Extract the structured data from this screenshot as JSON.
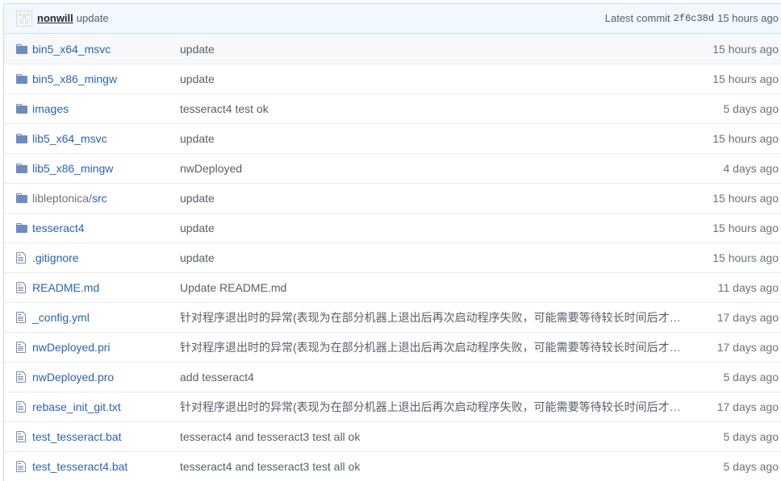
{
  "header": {
    "author": "nonwill",
    "commit_message": "update",
    "latest_commit_label": "Latest commit",
    "commit_sha": "2f6c38d",
    "commit_age": "15 hours ago"
  },
  "files": [
    {
      "icon": "folder-icon",
      "name": "bin5_x64_msvc",
      "message": "update",
      "age": "15 hours ago"
    },
    {
      "icon": "folder-icon",
      "name": "bin5_x86_mingw",
      "message": "update",
      "age": "15 hours ago"
    },
    {
      "icon": "folder-icon",
      "name": "images",
      "message": "tesseract4 test ok",
      "age": "5 days ago"
    },
    {
      "icon": "folder-icon",
      "name": "lib5_x64_msvc",
      "message": "update",
      "age": "15 hours ago"
    },
    {
      "icon": "folder-icon",
      "name": "lib5_x86_mingw",
      "message": "nwDeployed",
      "age": "4 days ago"
    },
    {
      "icon": "folder-icon",
      "path_prefix": "libleptonica/",
      "name": "src",
      "message": "update",
      "age": "15 hours ago"
    },
    {
      "icon": "folder-icon",
      "name": "tesseract4",
      "message": "update",
      "age": "15 hours ago"
    },
    {
      "icon": "file-icon",
      "name": ".gitignore",
      "message": "update",
      "age": "15 hours ago"
    },
    {
      "icon": "file-icon",
      "name": "README.md",
      "message": "Update README.md",
      "age": "11 days ago"
    },
    {
      "icon": "file-icon",
      "name": "_config.yml",
      "message": "针对程序退出时的异常(表现为在部分机器上退出后再次启动程序失败，可能需要等待较长时间后才…",
      "age": "17 days ago"
    },
    {
      "icon": "file-icon",
      "name": "nwDeployed.pri",
      "message": "针对程序退出时的异常(表现为在部分机器上退出后再次启动程序失败，可能需要等待较长时间后才…",
      "age": "17 days ago"
    },
    {
      "icon": "file-icon",
      "name": "nwDeployed.pro",
      "message": "add tesseract4",
      "age": "5 days ago"
    },
    {
      "icon": "file-icon",
      "name": "rebase_init_git.txt",
      "message": "针对程序退出时的异常(表现为在部分机器上退出后再次启动程序失败，可能需要等待较长时间后才…",
      "age": "17 days ago"
    },
    {
      "icon": "file-icon",
      "name": "test_tesseract.bat",
      "message": "tesseract4 and tesseract3 test all ok",
      "age": "5 days ago"
    },
    {
      "icon": "file-icon",
      "name": "test_tesseract4.bat",
      "message": "tesseract4 and tesseract3 test all ok",
      "age": "5 days ago"
    }
  ],
  "colors": {
    "link": "#2a64b6",
    "message_text": "#586069",
    "age_text": "#6a737d",
    "folder_icon": "#6d8cc0",
    "file_icon": "#7a8cae",
    "header_bg": "#f1f8ff",
    "header_border": "#c8e1ff",
    "hover_bg": "#f6f8fa"
  }
}
